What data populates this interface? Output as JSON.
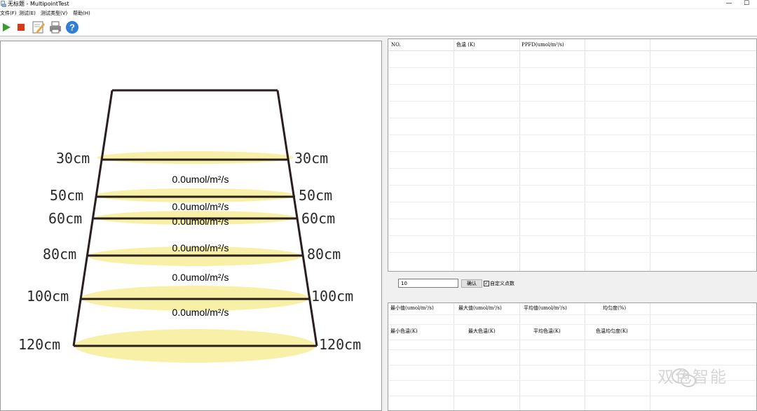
{
  "window": {
    "title": "无标题 - MultipointTest",
    "minimize_glyph": "—",
    "maximize_glyph": "☐"
  },
  "menu": [
    {
      "label": "文件(F)"
    },
    {
      "label": "测试(E)"
    },
    {
      "label": "测试类型(V)"
    },
    {
      "label": "帮助(H)"
    }
  ],
  "toolbar": {
    "buttons": [
      {
        "name": "play-icon",
        "color": "#3a9b2f"
      },
      {
        "name": "stop-icon",
        "color": "#d83a17"
      },
      {
        "name": "edit-icon",
        "color": "#e5a53c"
      },
      {
        "name": "print-icon",
        "color": "#8c8c8c"
      },
      {
        "name": "help-icon",
        "color": "#2f7fd6",
        "glyph": "?"
      }
    ]
  },
  "results_table": {
    "columns": [
      "NO.",
      "色温 (K)",
      "PPFD(umol/m²/s)"
    ]
  },
  "controls": {
    "point_count_value": "10",
    "confirm_label": "确认",
    "custom_checkbox_checked": true,
    "custom_checkbox_label": "自定义点数"
  },
  "summary_table": {
    "row1": [
      "最小值(umol/m²/s)",
      "最大值(umol/m²/s)",
      "平均值(umol/m²/s)",
      "均匀度(%)"
    ],
    "row2": [
      "最小色温(K)",
      "最大色温(K)",
      "平均色温(K)",
      "色温均匀度(K)"
    ]
  },
  "diagram": {
    "distances": [
      {
        "left": "30cm",
        "right": "30cm"
      },
      {
        "left": "50cm",
        "right": "50cm"
      },
      {
        "left": "60cm",
        "right": "60cm"
      },
      {
        "left": "80cm",
        "right": "80cm"
      },
      {
        "left": "100cm",
        "right": "100cm"
      },
      {
        "left": "120cm",
        "right": "120cm"
      }
    ],
    "readings": [
      "0.0umol/m²/s",
      "0.0umol/m²/s",
      "0.0umol/m²/s",
      "0.0umol/m²/s",
      "0.0umol/m²/s",
      "0.0umol/m²/s"
    ],
    "light_color": "#f8f0a6",
    "frame_color": "#2a1f1f"
  },
  "watermark": {
    "text": "双色智能"
  }
}
